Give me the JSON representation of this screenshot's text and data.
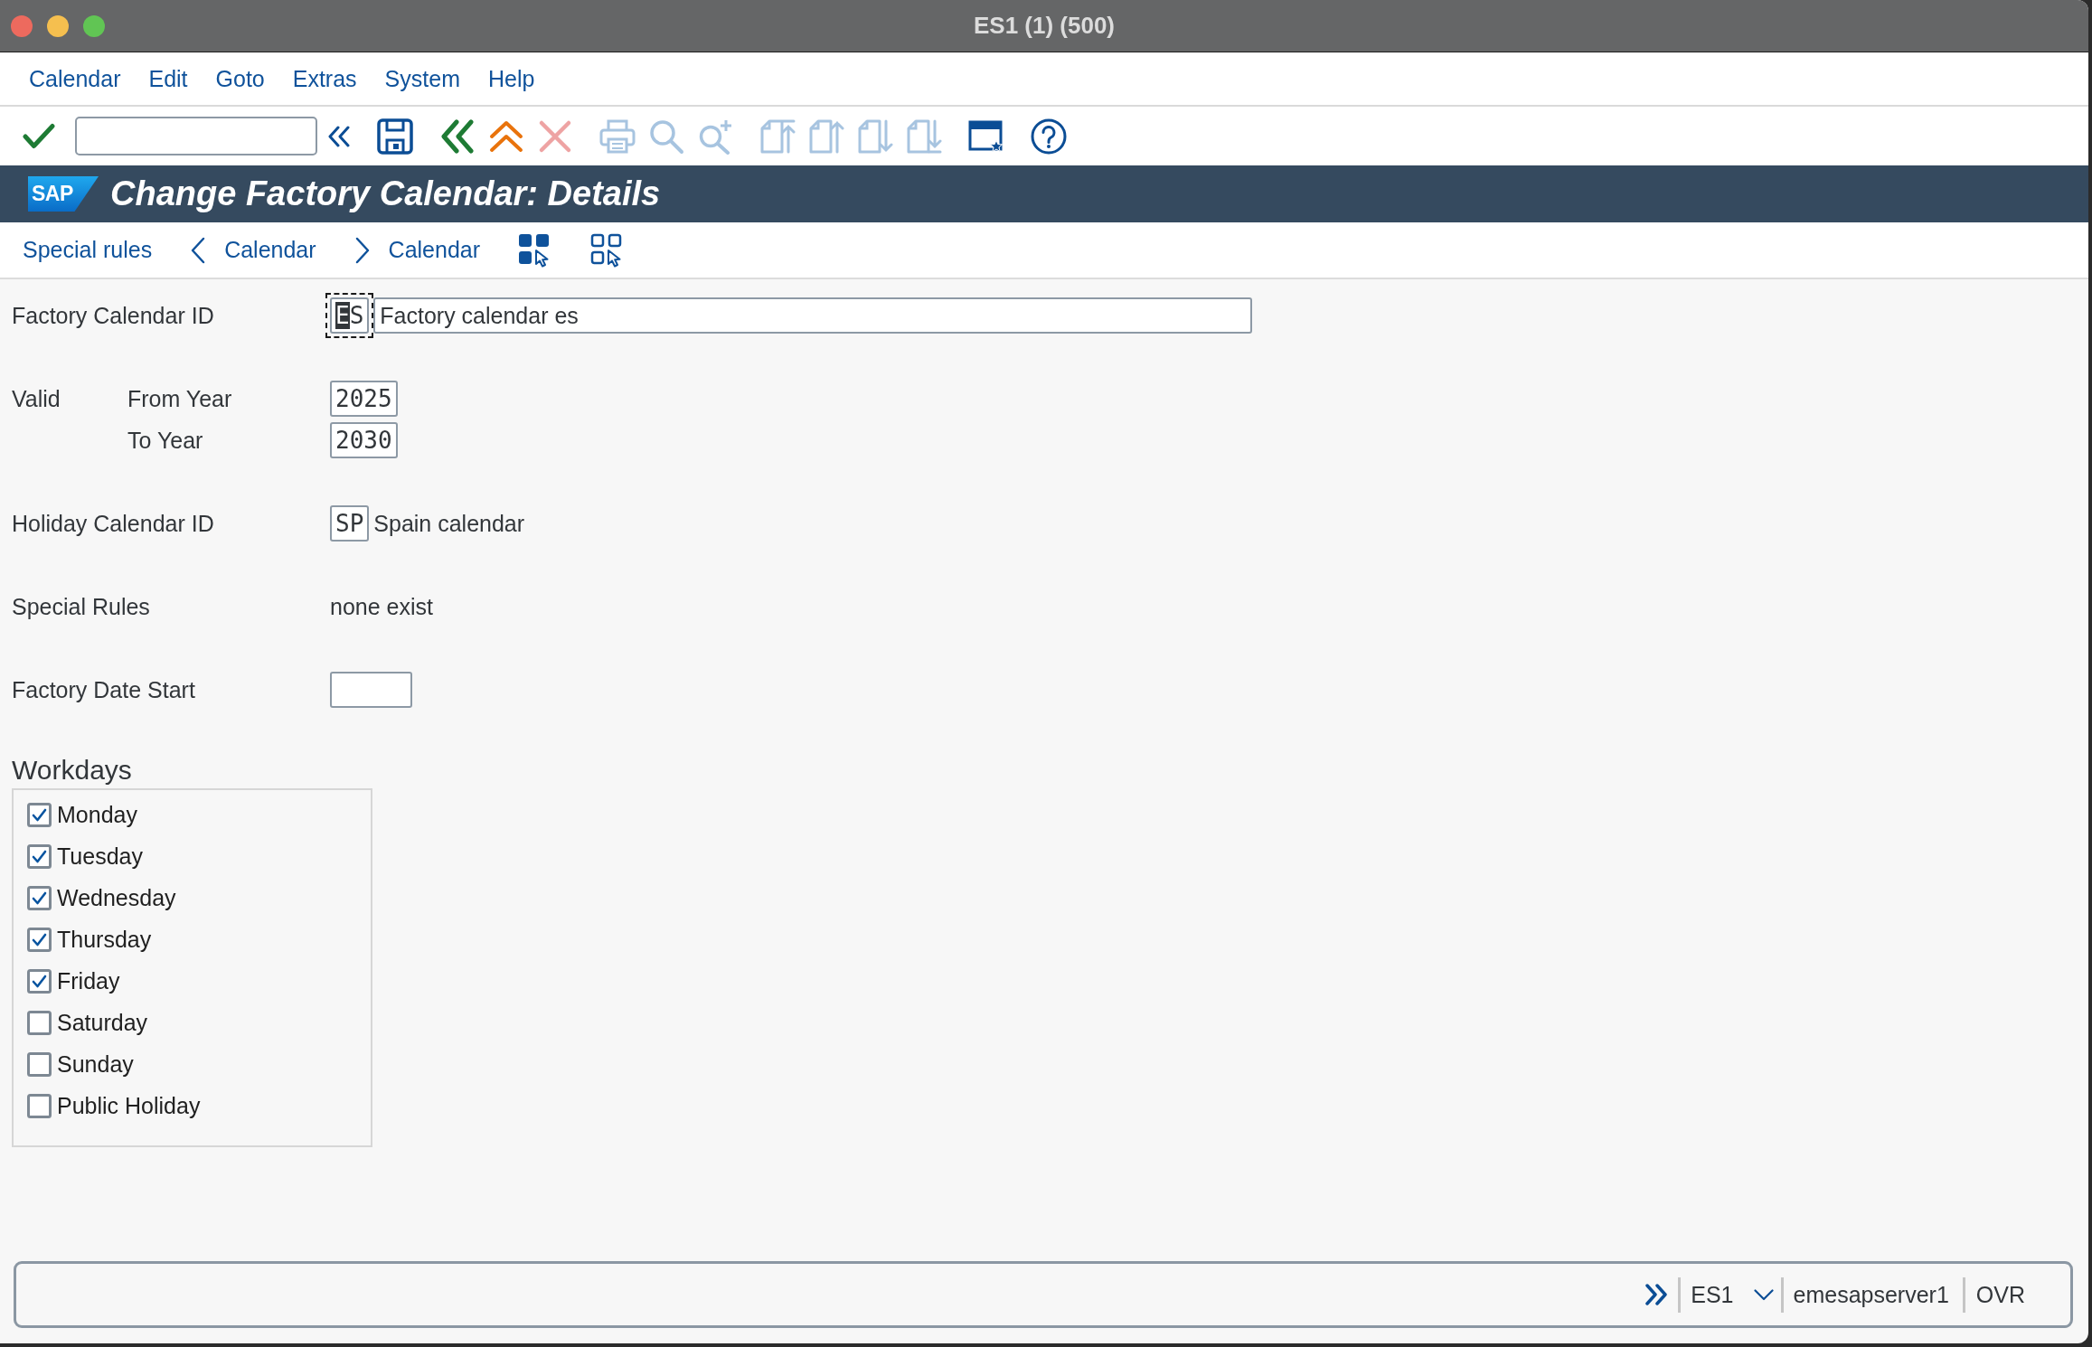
{
  "window": {
    "title": "ES1 (1) (500)"
  },
  "menu": [
    "Calendar",
    "Edit",
    "Goto",
    "Extras",
    "System",
    "Help"
  ],
  "toolbar": {
    "groups": [
      {
        "buttons": [
          {
            "kind": "enter",
            "disabled": false
          },
          {
            "kind": "command_field",
            "disabled": false
          },
          {
            "kind": "collapse",
            "disabled": false
          }
        ]
      },
      {
        "buttons": [
          {
            "kind": "save",
            "disabled": false
          }
        ]
      },
      {
        "buttons": [
          {
            "kind": "back",
            "disabled": false
          },
          {
            "kind": "exit",
            "disabled": false
          },
          {
            "kind": "cancel",
            "disabled": true
          }
        ]
      },
      {
        "buttons": [
          {
            "kind": "print",
            "disabled": true
          },
          {
            "kind": "find",
            "disabled": true
          },
          {
            "kind": "find_next",
            "disabled": true
          }
        ]
      },
      {
        "buttons": [
          {
            "kind": "first_page",
            "disabled": true
          },
          {
            "kind": "previous_page",
            "disabled": true
          },
          {
            "kind": "next_page",
            "disabled": true
          },
          {
            "kind": "last_page",
            "disabled": true
          }
        ]
      },
      {
        "buttons": [
          {
            "kind": "new_session",
            "disabled": false
          }
        ]
      },
      {
        "buttons": [
          {
            "kind": "help",
            "disabled": false
          }
        ]
      }
    ]
  },
  "header": {
    "logo": "SAP",
    "title": "Change Factory Calendar: Details"
  },
  "app_toolbar": [
    {
      "kind": "text",
      "label": "Special rules"
    },
    {
      "kind": "previous",
      "label": "Calendar"
    },
    {
      "kind": "next",
      "label": "Calendar"
    },
    {
      "kind": "select_all"
    },
    {
      "kind": "deselect_all"
    }
  ],
  "form": {
    "factory_calendar_id": {
      "label": "Factory Calendar ID",
      "value": "ES",
      "focused": true,
      "description": "Factory calendar es"
    },
    "valid": {
      "label": "Valid",
      "from_year": {
        "label": "From Year",
        "value": "2025"
      },
      "to_year": {
        "label": "To Year",
        "value": "2030"
      }
    },
    "holiday_calendar_id": {
      "label": "Holiday Calendar ID",
      "value": "SP",
      "description": "Spain calendar"
    },
    "special_rules": {
      "label": "Special Rules",
      "value": "none exist"
    },
    "factory_date_start": {
      "label": "Factory Date Start"
    }
  },
  "workdays": {
    "title": "Workdays",
    "days": [
      {
        "label": "Monday",
        "checked": true
      },
      {
        "label": "Tuesday",
        "checked": true
      },
      {
        "label": "Wednesday",
        "checked": true
      },
      {
        "label": "Thursday",
        "checked": true
      },
      {
        "label": "Friday",
        "checked": true
      },
      {
        "label": "Saturday",
        "checked": false
      },
      {
        "label": "Sunday",
        "checked": false
      },
      {
        "label": "Public Holiday",
        "checked": false
      }
    ]
  },
  "status_bar": {
    "system": "ES1",
    "server": "emesapserver1",
    "mode": "OVR"
  }
}
